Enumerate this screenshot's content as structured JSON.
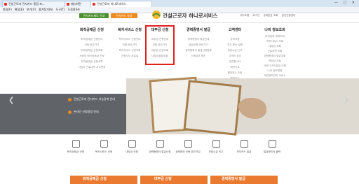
{
  "browser": {
    "tabs": [
      {
        "label": "건설근로자 전자카드 통합 포..."
      },
      {
        "label": "메뉴화면"
      },
      {
        "label": "건설근로자 하나로서비스"
      }
    ],
    "window_buttons": "— ▢ ✕",
    "menu": [
      "파일(F)",
      "편집(E)",
      "보기(V)",
      "즐겨찾기(A)",
      "도구(T)",
      "도움말(H)"
    ]
  },
  "header": {
    "btn_left": "전자카드제도 안내",
    "btn_right": "전자카드 발급",
    "logo_text": "건설근로자 하나로서비스",
    "util_links": [
      "사이트맵",
      "로그인",
      "공제번호 조회",
      "공인인증센터"
    ]
  },
  "gnb": [
    {
      "head": "퇴직공제금 신청",
      "subs": [
        "퇴직공제금 신청안내",
        "신청 바로가기",
        "퇴직공제금 신청조회",
        "사망자 퇴직공제금 신청",
        "퇴직공제금 신청서류",
        "사업주 근로내역 서식변경"
      ]
    },
    {
      "head": "복지서비스 신청",
      "subs": [
        "복지서비스 신청안내",
        "신청 바로가기",
        "복지서비스 신청조회",
        "신청서식 자료실"
      ]
    },
    {
      "head": "대부금 신청",
      "subs": [
        "대부금 신청안내",
        "신청 바로가기",
        "대부금 신청조회",
        "대부금상환조회"
      ]
    },
    {
      "head": "경력증명서 발급",
      "subs": [
        "경력증명서 발급안내",
        "발급신청 바로가기",
        "경력증명서 발급신청현황",
        "진위여부 확인"
      ]
    },
    {
      "head": "고객센터",
      "subs": [
        "공지사항",
        "자주 묻는 질문",
        "부정수급 신고",
        "고객의 소리",
        "칭찬합시다",
        "제안신고",
        "원천징수 조회",
        "원하우스"
      ]
    },
    {
      "head": "나의 정보조회",
      "subs": [
        "퇴직공제 내역조회",
        "복지서비스 조회",
        "대부금 조회",
        "근로내역 조회",
        "경력증명서 발급조회",
        "적립금 조회",
        "근로자 카드발급 조회",
        "나의 정보변경",
        "개인정보관리 서비스",
        "탈퇴"
      ]
    }
  ],
  "hero": {
    "line1": "건설근로자 전자카드 기능강화 안내",
    "line2": "온라인 신청방법 안내"
  },
  "quick": [
    {
      "label": "퇴직공제금 신청",
      "icon": "coin-icon"
    },
    {
      "label": "복지서비스 신청",
      "icon": "heart-icon"
    },
    {
      "label": "대부금 신청",
      "icon": "document-icon"
    },
    {
      "label": "경력증명서 발급신청",
      "icon": "certificate-icon"
    },
    {
      "label": "공제정보 인증 본인가입",
      "icon": "id-card-icon"
    },
    {
      "label": "부정수급 신고",
      "icon": "warning-icon"
    },
    {
      "label": "전자카드 발급",
      "icon": "card-icon"
    },
    {
      "label": "발급확인서 출력",
      "icon": "print-icon"
    }
  ],
  "bottom": [
    "퇴직공제금 신청",
    "대부금 신청",
    "경력증명서 발급"
  ],
  "colors": {
    "accent_green": "#4d8f2f",
    "accent_orange": "#f08a1d",
    "highlight_red": "#e0211b"
  }
}
